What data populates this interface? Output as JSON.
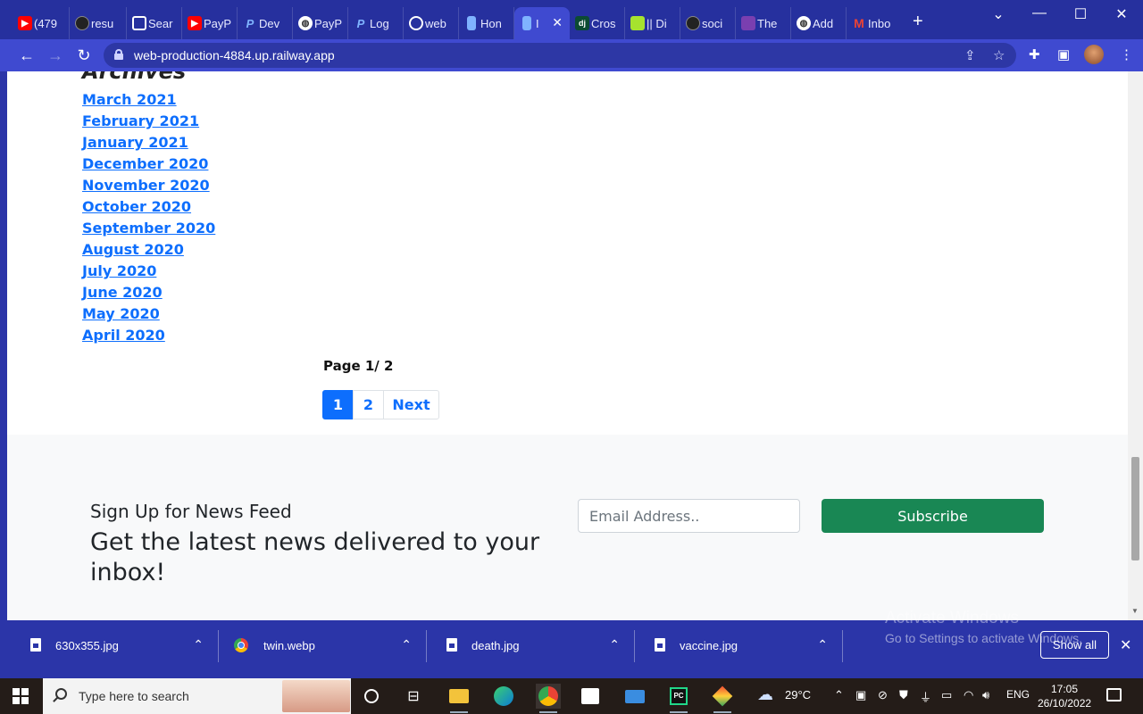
{
  "browser": {
    "tabs": [
      {
        "label": "(479",
        "icon": "youtube-icon",
        "color": "#ff0000"
      },
      {
        "label": "resu",
        "icon": "github-icon",
        "color": "#333333"
      },
      {
        "label": "Sear",
        "icon": "flag-icon",
        "color": "#3f4ad0"
      },
      {
        "label": "PayP",
        "icon": "youtube-icon",
        "color": "#ff0000"
      },
      {
        "label": "Dev",
        "icon": "paypal-icon",
        "color": "#1a73e8"
      },
      {
        "label": "PayP",
        "icon": "globe-icon",
        "color": "#ffffff"
      },
      {
        "label": "Log",
        "icon": "paypal-icon",
        "color": "#1a73e8"
      },
      {
        "label": "web",
        "icon": "chatgpt-icon",
        "color": "#ffffff"
      },
      {
        "label": "Hon",
        "icon": "bookmark-icon",
        "color": "#7fb3ff"
      },
      {
        "label": "I",
        "icon": "bookmark-icon",
        "color": "#7fb3ff",
        "active": true
      },
      {
        "label": "Cros",
        "icon": "django-icon",
        "color": "#0c4b33"
      },
      {
        "label": "|| Di",
        "icon": "leaf-icon",
        "color": "#a6e22e"
      },
      {
        "label": "soci",
        "icon": "github-icon",
        "color": "#333333"
      },
      {
        "label": "The",
        "icon": "rand-icon",
        "color": "#7a3fb0"
      },
      {
        "label": "Add",
        "icon": "globe-icon",
        "color": "#ffffff"
      },
      {
        "label": "Inbo",
        "icon": "gmail-icon",
        "color": "#ea4335"
      }
    ],
    "tab_close": "✕",
    "new_tab": "+",
    "url": "web-production-4884.up.railway.app",
    "window_controls": {
      "minimize": "—",
      "maximize": "☐",
      "close": "✕",
      "tab_search": "⌄"
    }
  },
  "page": {
    "archives_title": "Archives",
    "archives": [
      "March 2021",
      "February 2021",
      "January 2021",
      "December 2020",
      "November 2020",
      "October 2020",
      "September 2020",
      "August 2020",
      "July 2020",
      "June 2020",
      "May 2020",
      "April 2020"
    ],
    "page_info": "Page 1/ 2",
    "pagination": {
      "page1": "1",
      "page2": "2",
      "next": "Next"
    },
    "newsletter": {
      "subtitle": "Sign Up for News Feed",
      "headline": "Get the latest news delivered to your inbox!",
      "email_placeholder": "Email Address..",
      "subscribe_label": "Subscribe"
    }
  },
  "downloads": {
    "items": [
      {
        "name": "630x355.jpg",
        "icon": "file-icon"
      },
      {
        "name": "twin.webp",
        "icon": "chrome-icon"
      },
      {
        "name": "death.jpg",
        "icon": "file-icon"
      },
      {
        "name": "vaccine.jpg",
        "icon": "file-icon"
      }
    ],
    "show_all": "Show all",
    "close": "✕",
    "activate_line1": "Activate Windows",
    "activate_line2": "Go to Settings to activate Windows."
  },
  "taskbar": {
    "search_placeholder": "Type here to search",
    "weather": "29°C",
    "language": "ENG",
    "time": "17:05",
    "date": "26/10/2022"
  },
  "colors": {
    "browser_accent": "#2b35a8",
    "link": "#0d6efd",
    "subscribe": "#198754"
  }
}
